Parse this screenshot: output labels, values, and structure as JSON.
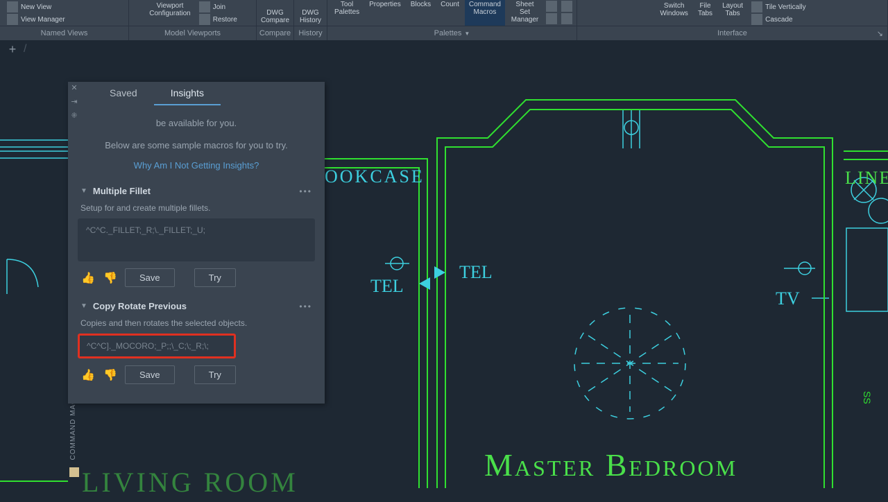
{
  "ribbon": {
    "left_items": [
      {
        "label": "New View",
        "icon": "new-view-icon"
      },
      {
        "label": "View Manager",
        "icon": "view-manager-icon"
      }
    ],
    "viewport": {
      "main": "Viewport\nConfiguration",
      "join": "Join",
      "restore": "Restore"
    },
    "compare": {
      "dwg_compare": "DWG\nCompare",
      "dwg_history": "DWG\nHistory"
    },
    "palettes": {
      "tool": "Tool\nPalettes",
      "properties": "Properties",
      "blocks": "Blocks",
      "count": "Count",
      "cmd_macros": "Command\nMacros",
      "sheet": "Sheet Set\nManager"
    },
    "windows": {
      "switch": "Switch\nWindows",
      "file_tabs": "File\nTabs",
      "layout_tabs": "Layout\nTabs",
      "tile_v": "Tile Vertically",
      "cascade": "Cascade"
    },
    "group_labels": {
      "named": "Named Views",
      "viewports": "Model Viewports",
      "compare": "Compare",
      "history": "History",
      "palettes": "Palettes",
      "interface": "Interface"
    }
  },
  "panel": {
    "title_side": "COMMAND MACROS",
    "tabs": {
      "saved": "Saved",
      "insights": "Insights"
    },
    "intro1": "be available for you.",
    "intro2": "Below are some sample macros for you to try.",
    "intro_link": "Why Am I Not Getting Insights?",
    "macros": [
      {
        "title": "Multiple Fillet",
        "desc": "Setup for and create multiple fillets.",
        "code": "^C^C._FILLET;_R;\\._FILLET;_U;"
      },
      {
        "title": "Copy Rotate Previous",
        "desc": "Copies and then rotates the selected objects.",
        "code": "^C^C]._MOCORO;_P;;\\_C;\\;_R;\\;"
      }
    ],
    "btn_save": "Save",
    "btn_try": "Try"
  },
  "drawing": {
    "bookcase": "OOKCASE",
    "tel1": "TEL",
    "tel2": "TEL",
    "tv": "TV",
    "liner": "LINE",
    "master": "Master Bedroom",
    "living": "LIVING ROOM"
  }
}
